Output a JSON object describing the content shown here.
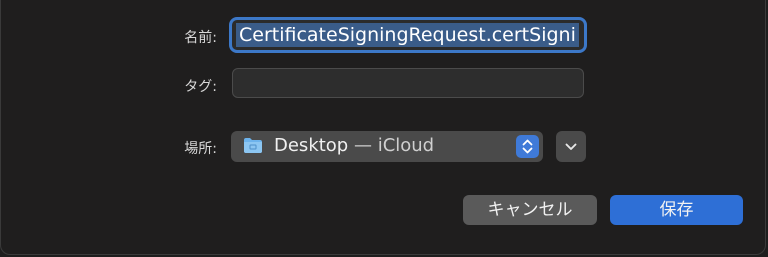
{
  "dialog": {
    "name_label": "名前:",
    "name_value": "CertificateSigningRequest.certSigni",
    "tags_label": "タグ:",
    "tags_value": "",
    "location_label": "場所:",
    "location": {
      "folder": "Desktop",
      "separator": " — ",
      "service": "iCloud",
      "icon": "folder-icon"
    },
    "cancel_label": "キャンセル",
    "save_label": "保存"
  },
  "colors": {
    "accent": "#2e6fd6",
    "focus_ring": "#3c78c8",
    "selection": "#3a5c89",
    "background": "#1f1e1e",
    "control": "#4a4a4a"
  }
}
